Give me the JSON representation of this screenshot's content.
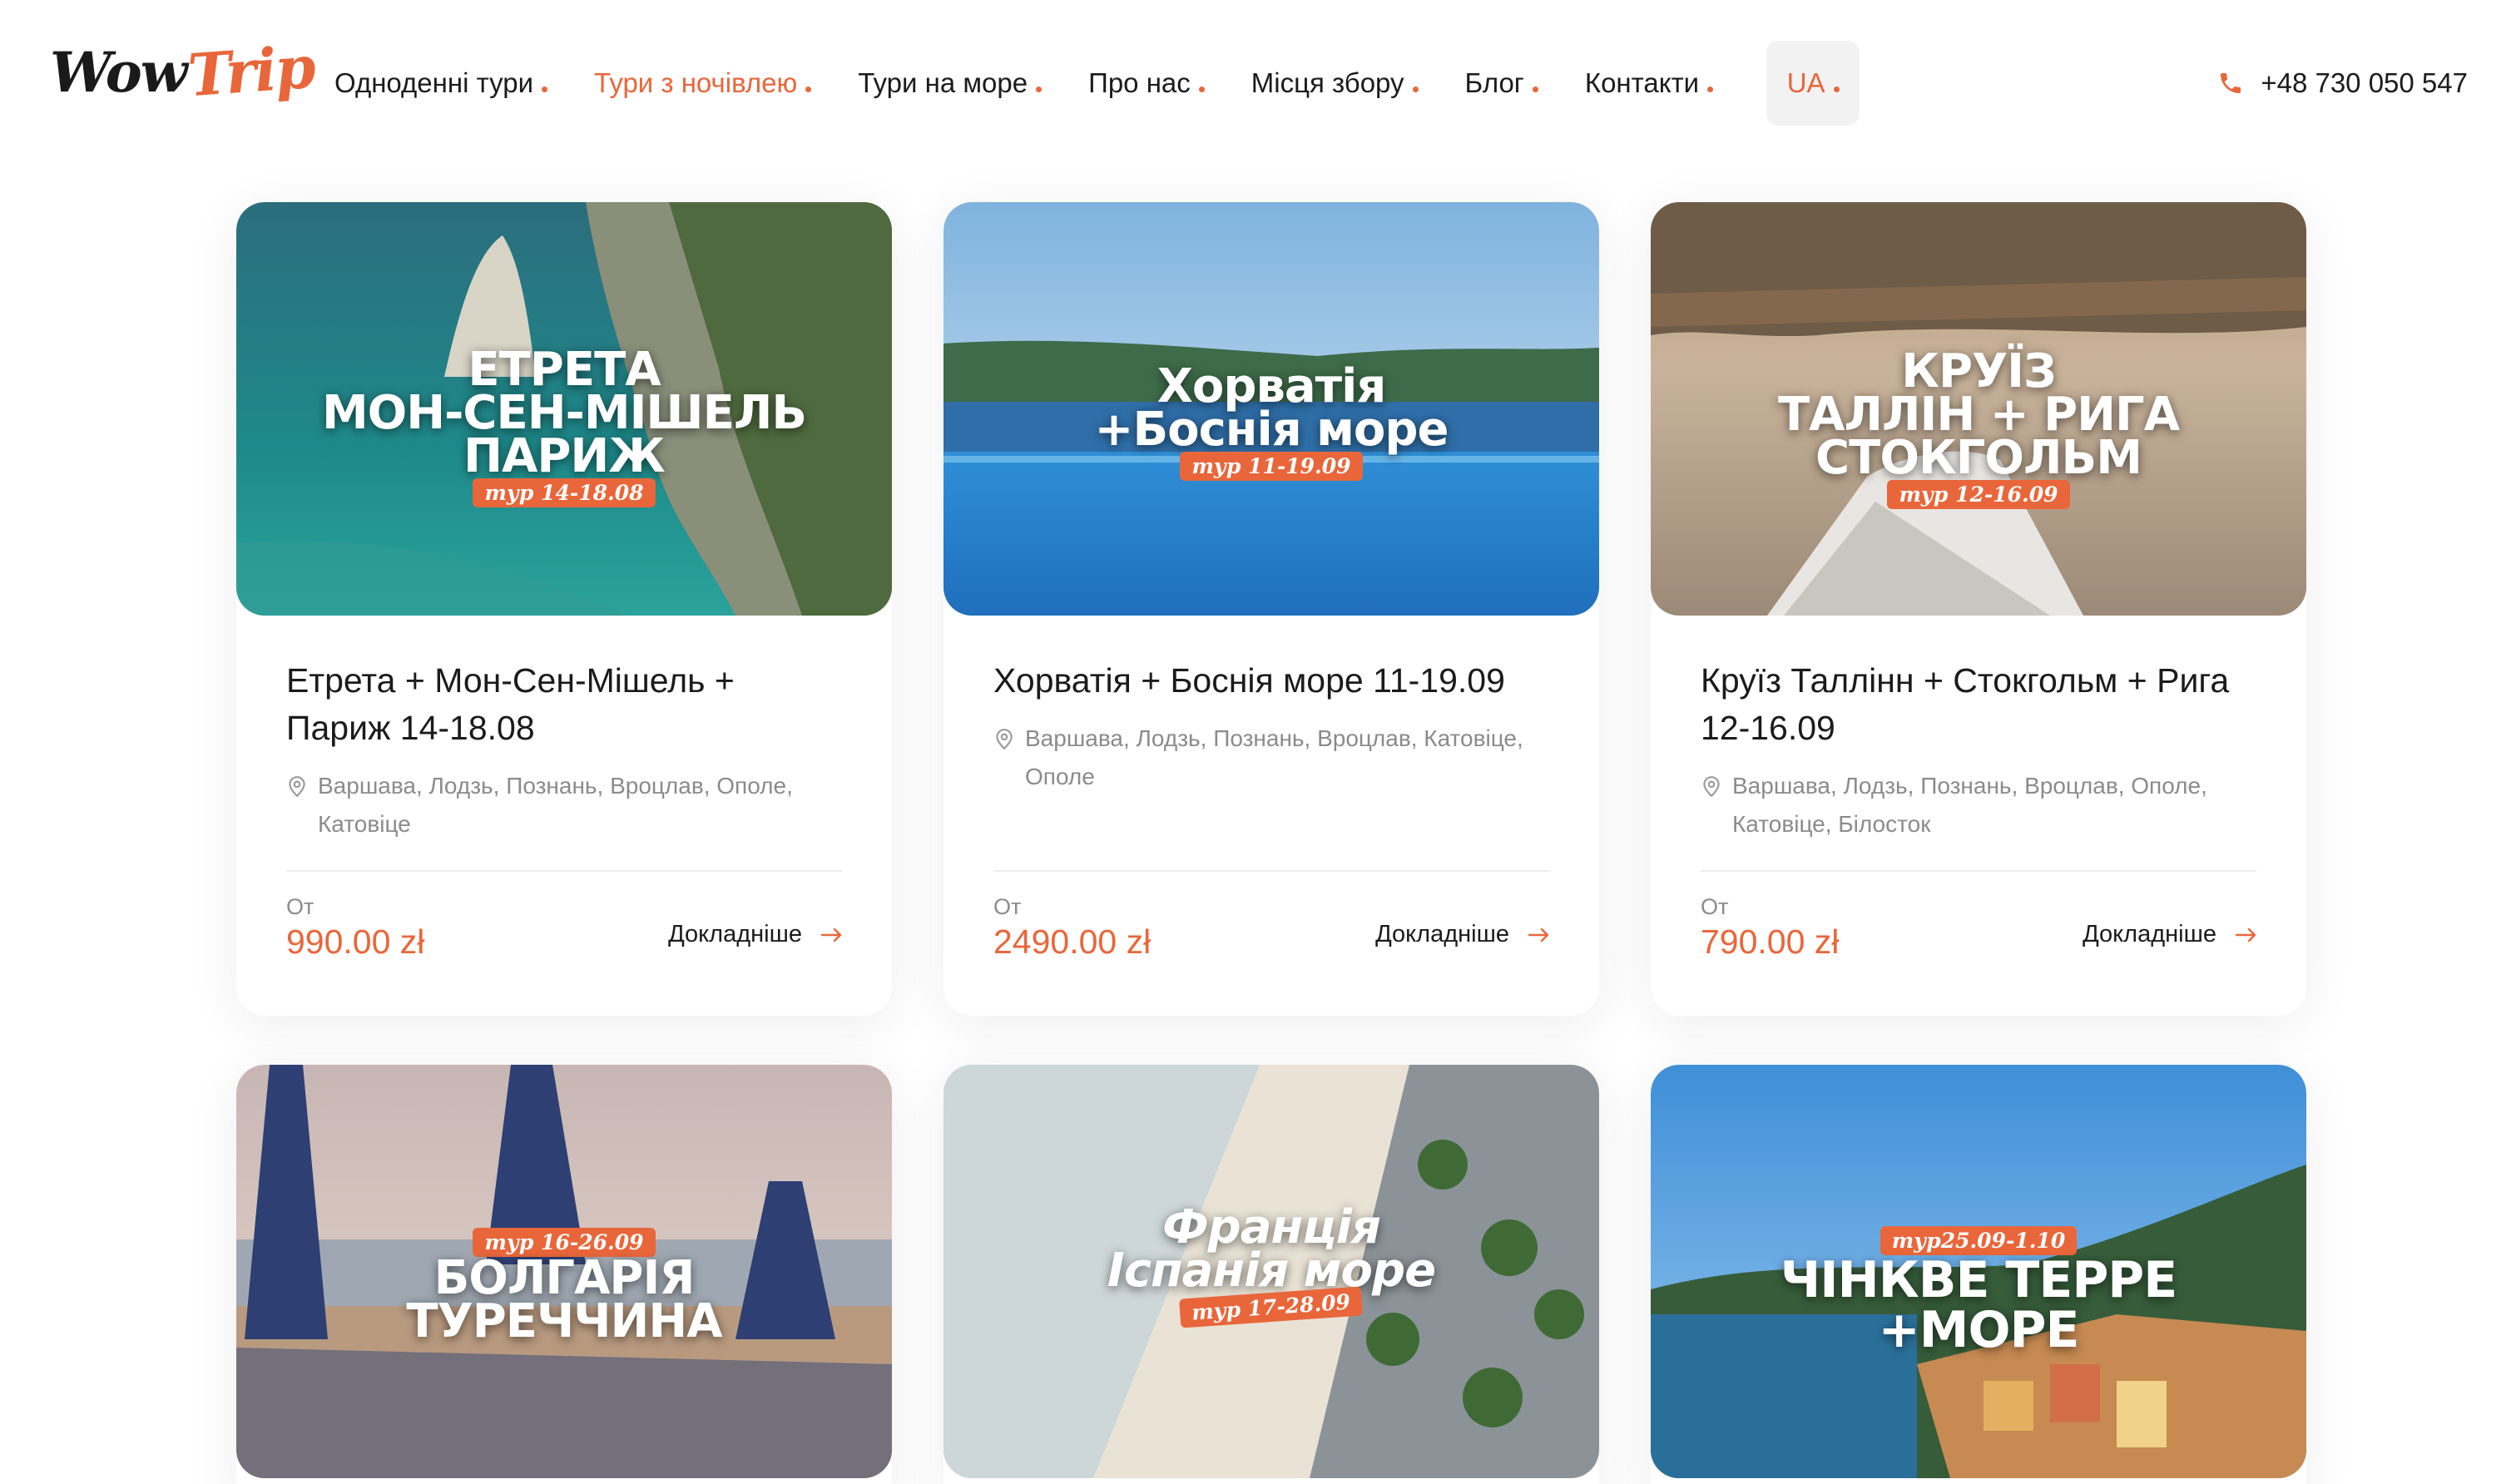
{
  "header": {
    "logo": {
      "part1": "Wow",
      "part2": "Trip"
    },
    "nav": [
      {
        "label": "Одноденні тури",
        "active": false
      },
      {
        "label": "Тури з ночівлею",
        "active": true
      },
      {
        "label": "Тури на море",
        "active": false
      },
      {
        "label": "Про нас",
        "active": false
      },
      {
        "label": "Місця збору",
        "active": false
      },
      {
        "label": "Блог",
        "active": false
      },
      {
        "label": "Контакти",
        "active": false
      }
    ],
    "lang": "UA",
    "phone": "+48 730 050 547",
    "phone_icon": "phone-icon"
  },
  "colors": {
    "accent": "#e9663a",
    "text": "#1b1b1b",
    "muted": "#8b8b8b"
  },
  "cards": [
    {
      "image_lines": [
        "ЕТРЕТА",
        "МОН-СЕН-МІШЕЛЬ",
        "ПАРИЖ"
      ],
      "image_tag": "тур 14-18.08",
      "title": "Етрета + Мон-Сен-Мішель + Париж 14-18.08",
      "locations": "Варшава, Лодзь, Познань, Вроцлав, Ополе, Катовіце",
      "price_label": "От",
      "price": "990.00 zł",
      "more": "Докладніше"
    },
    {
      "image_lines": [
        "Хорватія",
        "+Боснія море"
      ],
      "image_tag": "тур 11-19.09",
      "title": "Хорватія + Боснія море 11-19.09",
      "locations": "Варшава, Лодзь, Познань, Вроцлав, Катовіце, Ополе",
      "price_label": "От",
      "price": "2490.00 zł",
      "more": "Докладніше"
    },
    {
      "image_lines": [
        "КРУЇЗ",
        "ТАЛЛІН + РИГА",
        "СТОКГОЛЬМ"
      ],
      "image_tag": "тур 12-16.09",
      "title": "Круїз Таллінн + Стокгольм + Рига 12-16.09",
      "locations": "Варшава, Лодзь, Познань, Вроцлав, Ополе, Катовіце, Білосток",
      "price_label": "От",
      "price": "790.00 zł",
      "more": "Докладніше"
    },
    {
      "image_lines": [
        "БОЛГАРІЯ",
        "ТУРЕЧЧИНА"
      ],
      "image_tag": "тур 16-26.09"
    },
    {
      "image_lines": [
        "Франція",
        "Іспанія море"
      ],
      "image_tag": "тур 17-28.09"
    },
    {
      "image_lines": [
        "ЧІНКВЕ ТЕРРЕ",
        "+МОРЕ"
      ],
      "image_tag": "тур25.09-1.10"
    }
  ]
}
